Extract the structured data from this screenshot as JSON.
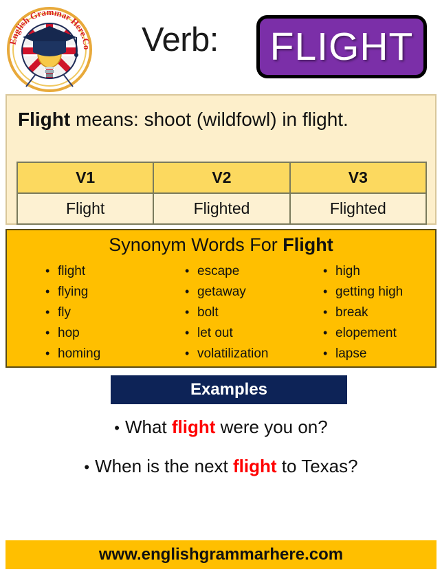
{
  "logo": {
    "arc_text_left": "English Grammar",
    "arc_text_right": "Here.Com",
    "icon_name": "graduation-cap-lightbulb-uk-flag-logo"
  },
  "header": {
    "part_of_speech_label": "Verb:",
    "word": "FLIGHT",
    "badge_color": "#7b2fa8"
  },
  "definition": {
    "word": "Flight",
    "connector": " means: ",
    "meaning": "shoot (wildfowl) in flight."
  },
  "verb_table": {
    "headers": [
      "V1",
      "V2",
      "V3"
    ],
    "values": [
      "Flight",
      "Flighted",
      "Flighted"
    ],
    "header_bg": "#fcd95f",
    "cell_bg": "#fdf1d2"
  },
  "synonyms": {
    "title_prefix": "Synonym Words For ",
    "title_word": "Flight",
    "bg_color": "#ffbf00",
    "columns": [
      [
        "flight",
        "flying",
        "fly",
        "hop",
        "homing"
      ],
      [
        "escape",
        "getaway",
        "bolt",
        "let out",
        "volatilization"
      ],
      [
        "high",
        "getting high",
        "break",
        "elopement",
        "lapse"
      ]
    ]
  },
  "examples": {
    "banner_label": "Examples",
    "banner_color": "#0d2357",
    "highlight_color": "#ff0000",
    "items": [
      {
        "before": "What ",
        "highlight": "flight",
        "after": " were you on?"
      },
      {
        "before": "When is the next ",
        "highlight": "flight",
        "after": " to Texas?"
      }
    ]
  },
  "footer": {
    "website": "www.englishgrammarhere.com",
    "bg_color": "#ffbf00"
  }
}
